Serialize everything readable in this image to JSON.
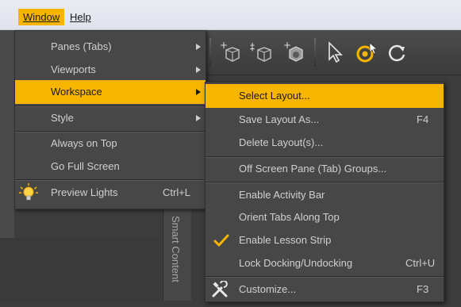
{
  "menubar": {
    "items": [
      {
        "label": "Window",
        "active": true
      },
      {
        "label": "Help",
        "active": false
      }
    ]
  },
  "window_menu": {
    "items": [
      {
        "label": "Panes (Tabs)",
        "submenu": true
      },
      {
        "label": "Viewports",
        "submenu": true
      },
      {
        "label": "Workspace",
        "submenu": true,
        "highlighted": true
      },
      {
        "label": "Style",
        "submenu": true
      },
      {
        "label": "Always on Top"
      },
      {
        "label": "Go Full Screen"
      },
      {
        "label": "Preview Lights",
        "shortcut": "Ctrl+L",
        "icon": "bulb-icon"
      }
    ]
  },
  "workspace_menu": {
    "items": [
      {
        "label": "Select Layout...",
        "highlighted": true
      },
      {
        "label": "Save Layout As...",
        "shortcut": "F4"
      },
      {
        "label": "Delete Layout(s)..."
      },
      {
        "label": "Off Screen Pane (Tab) Groups..."
      },
      {
        "label": "Enable Activity Bar"
      },
      {
        "label": "Orient Tabs Along Top"
      },
      {
        "label": "Enable Lesson Strip",
        "checked": true
      },
      {
        "label": "Lock Docking/Undocking",
        "shortcut": "Ctrl+U"
      },
      {
        "label": "Customize...",
        "shortcut": "F3",
        "icon": "tools-icon"
      }
    ]
  },
  "side_panel": {
    "label": "Smart Content"
  },
  "colors": {
    "accent": "#f7b500",
    "menu_bg": "#474747",
    "menu_text": "#d0d0d0"
  }
}
